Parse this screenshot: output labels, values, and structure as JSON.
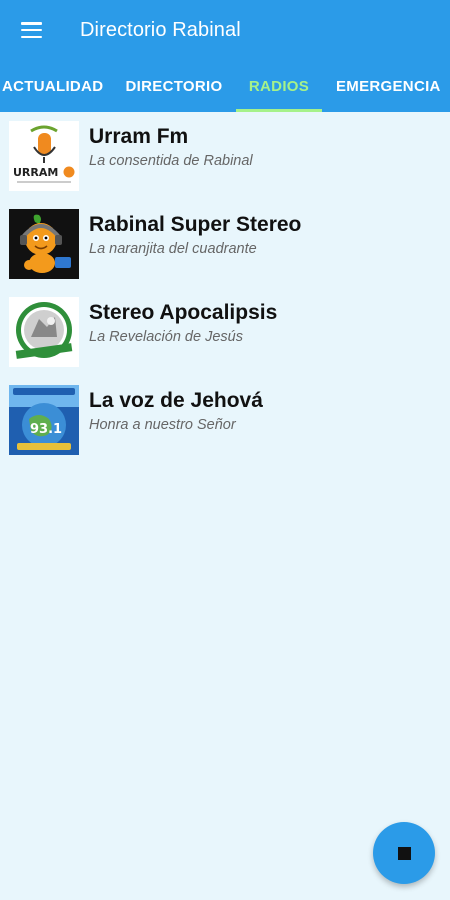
{
  "appbar": {
    "title": "Directorio Rabinal",
    "menu_icon": "hamburger-menu-icon"
  },
  "tabs": [
    {
      "label": "ACTUALIDAD",
      "active": false
    },
    {
      "label": "DIRECTORIO",
      "active": false
    },
    {
      "label": "RADIOS",
      "active": true
    },
    {
      "label": "EMERGENCIA",
      "active": false
    }
  ],
  "radios": [
    {
      "name": "Urram Fm",
      "slogan": "La consentida de Rabinal",
      "logo_text": "URRAM"
    },
    {
      "name": "Rabinal Super Stereo",
      "slogan": "La naranjita del cuadrante"
    },
    {
      "name": "Stereo Apocalipsis",
      "slogan": "La Revelación de Jesús"
    },
    {
      "name": "La voz de Jehová",
      "slogan": "Honra a nuestro Señor",
      "logo_text": "93.1"
    }
  ],
  "fab": {
    "icon": "stop-icon"
  },
  "colors": {
    "primary": "#2b9be8",
    "tab_active": "#a5f28a",
    "background": "#e8f6fc"
  }
}
